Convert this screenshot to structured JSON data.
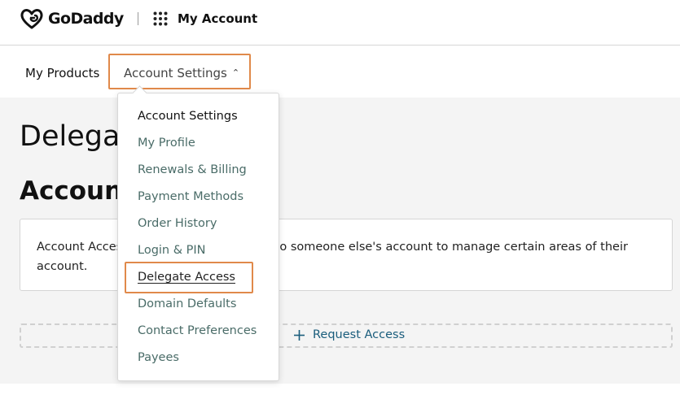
{
  "header": {
    "brand": "GoDaddy",
    "app_title": "My Account"
  },
  "nav": {
    "items": [
      {
        "label": "My Products"
      },
      {
        "label": "Account Settings"
      }
    ]
  },
  "main": {
    "page_title": "Delegate Access",
    "section_title": "Account Access",
    "info_text": "Account Access lets you request access to someone else's account to manage certain areas of their account.",
    "request_button_label": "Request Access"
  },
  "dropdown": {
    "items": [
      {
        "label": "Account Settings"
      },
      {
        "label": "My Profile"
      },
      {
        "label": "Renewals & Billing"
      },
      {
        "label": "Payment Methods"
      },
      {
        "label": "Order History"
      },
      {
        "label": "Login & PIN"
      },
      {
        "label": "Delegate Access"
      },
      {
        "label": "Domain Defaults"
      },
      {
        "label": "Contact Preferences"
      },
      {
        "label": "Payees"
      }
    ]
  },
  "colors": {
    "highlight": "#e0894a",
    "link": "#1a5d7c",
    "menu_text": "#4a6c68",
    "content_bg": "#f4f4f4"
  },
  "icons": [
    "godaddy-logo-icon",
    "apps-grid-icon",
    "chevron-up-icon",
    "plus-icon"
  ]
}
